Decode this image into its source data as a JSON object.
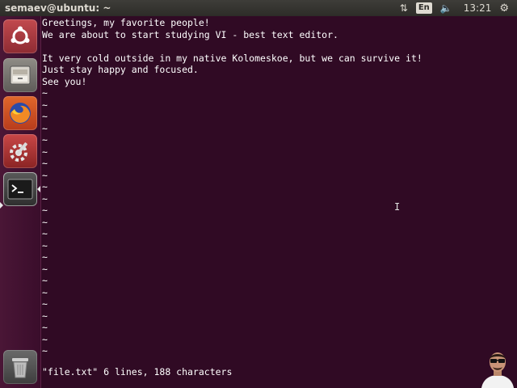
{
  "window": {
    "title": "semaev@ubuntu: ~"
  },
  "tray": {
    "network_icon": "network-arrows-icon",
    "language": "En",
    "volume_icon": "volume-icon",
    "time": "13:21",
    "settings_icon": "gear-icon"
  },
  "launcher": {
    "items": [
      {
        "name": "dash",
        "icon": "ubuntu-logo-icon"
      },
      {
        "name": "files",
        "icon": "files-cabinet-icon"
      },
      {
        "name": "firefox",
        "icon": "firefox-icon"
      },
      {
        "name": "system-settings",
        "icon": "settings-wrench-icon"
      },
      {
        "name": "terminal",
        "icon": "terminal-icon",
        "prompt_glyph": ">_"
      },
      {
        "name": "trash",
        "icon": "trash-icon"
      }
    ]
  },
  "editor": {
    "lines": [
      "Greetings, my favorite people!",
      "We are about to start studying VI - best text editor.",
      "",
      "It very cold outside in my native Kolomeskoe, but we can survive it!",
      "Just stay happy and focused.",
      "See you!"
    ],
    "empty_line_marker": "~",
    "status": "\"file.txt\" 6 lines, 188 characters"
  },
  "colors": {
    "terminal_bg": "#300a24",
    "panel_bg": "#3e3d39",
    "text": "#ffffff"
  }
}
